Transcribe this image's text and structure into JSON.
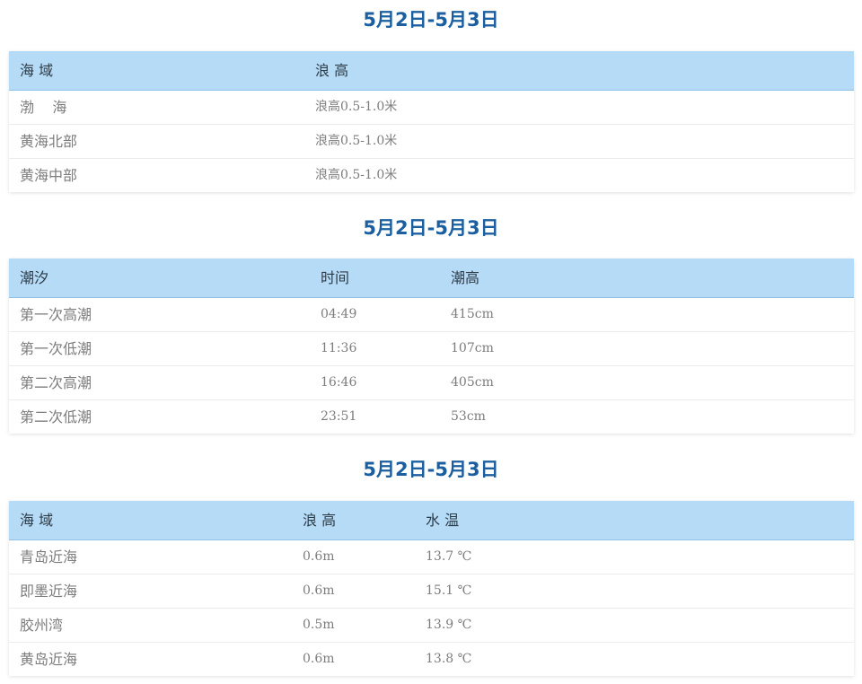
{
  "sections": [
    {
      "title": "5月2日-5月3日",
      "headers": [
        "海 域",
        "浪 高"
      ],
      "rows": [
        [
          "渤    海",
          "浪高0.5-1.0米"
        ],
        [
          "黄海北部",
          "浪高0.5-1.0米"
        ],
        [
          "黄海中部",
          "浪高0.5-1.0米"
        ]
      ]
    },
    {
      "title": "5月2日-5月3日",
      "headers": [
        "潮汐",
        "时间",
        "潮高"
      ],
      "rows": [
        [
          "第一次高潮",
          "04:49",
          "415cm"
        ],
        [
          "第一次低潮",
          "11:36",
          "107cm"
        ],
        [
          "第二次高潮",
          "16:46",
          "405cm"
        ],
        [
          "第二次低潮",
          "23:51",
          "53cm"
        ]
      ]
    },
    {
      "title": "5月2日-5月3日",
      "headers": [
        "海 域",
        "浪 高",
        "水 温"
      ],
      "rows": [
        [
          "青岛近海",
          "0.6m",
          "13.7 ℃"
        ],
        [
          "即墨近海",
          "0.6m",
          "15.1 ℃"
        ],
        [
          "胶州湾",
          "0.5m",
          "13.9 ℃"
        ],
        [
          "黄岛近海",
          "0.6m",
          "13.8 ℃"
        ]
      ]
    }
  ]
}
